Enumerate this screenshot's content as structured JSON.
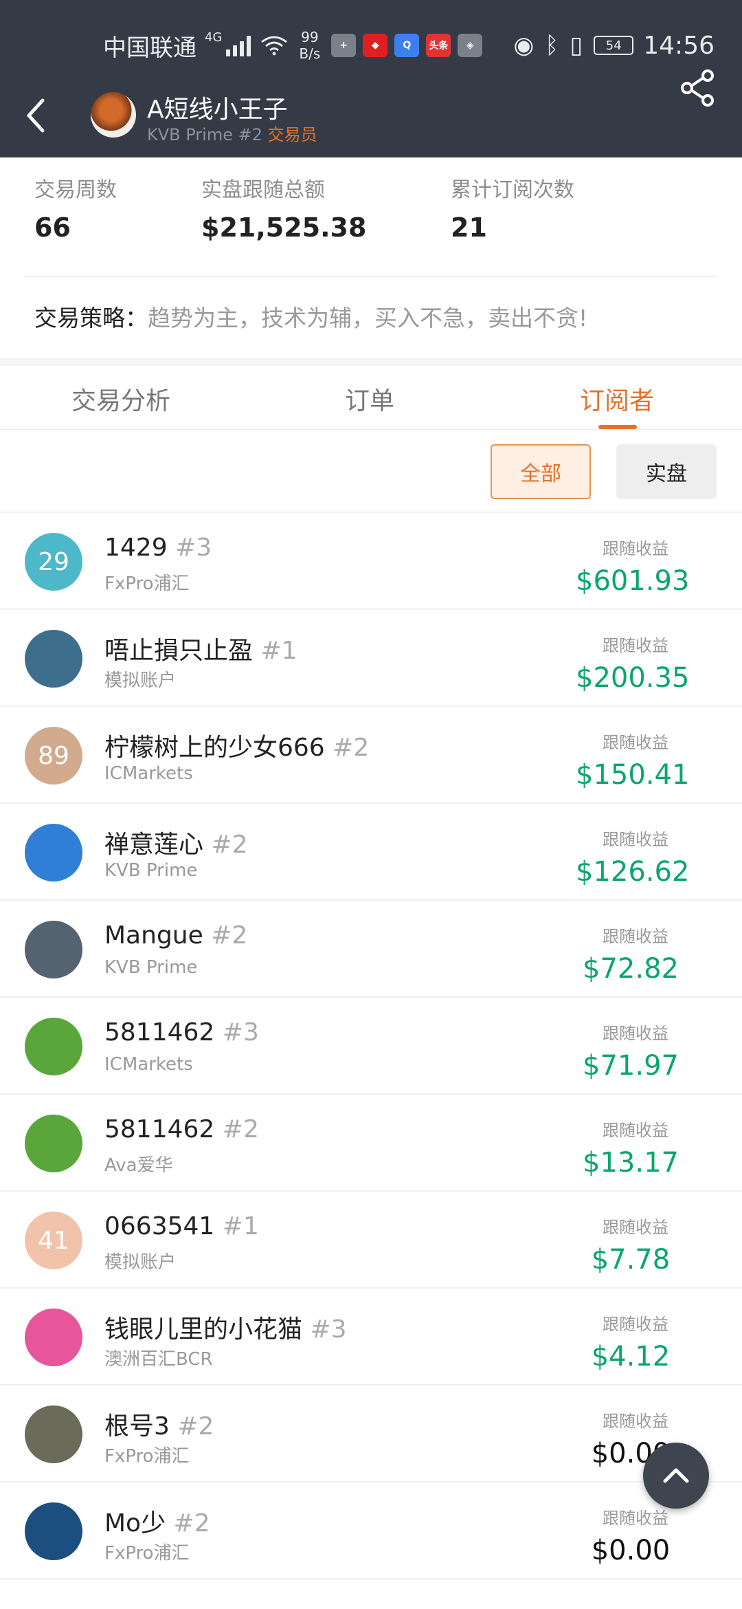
{
  "status_bar": {
    "carrier": "中国联通",
    "network": "4G",
    "speed_value": "99",
    "speed_unit": "B/s",
    "battery": "54",
    "time": "14:56",
    "app_icon_toutiao": "头条"
  },
  "header": {
    "trader_name": "A短线小王子",
    "trader_broker_rank": "KVB Prime #2",
    "trader_role": "交易员"
  },
  "stats": [
    {
      "label": "交易周数",
      "value": "66"
    },
    {
      "label": "实盘跟随总额",
      "value": "$21,525.38"
    },
    {
      "label": "累计订阅次数",
      "value": "21"
    }
  ],
  "strategy": {
    "label": "交易策略：",
    "value": "趋势为主，技术为辅，买入不急，卖出不贪!"
  },
  "tabs": [
    {
      "label": "交易分析",
      "active": false
    },
    {
      "label": "订单",
      "active": false
    },
    {
      "label": "订阅者",
      "active": true
    }
  ],
  "filters": {
    "all": "全部",
    "real": "实盘"
  },
  "return_label": "跟随收益",
  "subscribers": [
    {
      "name": "1429",
      "rank": "#3",
      "broker": "FxPro浦汇",
      "return": "$601.93",
      "avatar_text": "29",
      "avatar_color": "#4cb8c9"
    },
    {
      "name": "唔止損只止盈",
      "rank": "#1",
      "broker": "模拟账户",
      "return": "$200.35",
      "avatar_text": "",
      "avatar_color": "#3d6e8c"
    },
    {
      "name": "柠檬树上的少女666",
      "rank": "#2",
      "broker": "ICMarkets",
      "return": "$150.41",
      "avatar_text": "89",
      "avatar_color": "#d2ab8e"
    },
    {
      "name": "禅意莲心",
      "rank": "#2",
      "broker": "KVB Prime",
      "return": "$126.62",
      "avatar_text": "",
      "avatar_color": "#2f7fd6"
    },
    {
      "name": "Mangue",
      "rank": "#2",
      "broker": "KVB Prime",
      "return": "$72.82",
      "avatar_text": "",
      "avatar_color": "#556270"
    },
    {
      "name": "5811462",
      "rank": "#3",
      "broker": "ICMarkets",
      "return": "$71.97",
      "avatar_text": "",
      "avatar_color": "#5aa63b"
    },
    {
      "name": "5811462",
      "rank": "#2",
      "broker": "Ava爱华",
      "return": "$13.17",
      "avatar_text": "",
      "avatar_color": "#5aa63b"
    },
    {
      "name": "0663541",
      "rank": "#1",
      "broker": "模拟账户",
      "return": "$7.78",
      "avatar_text": "41",
      "avatar_color": "#f0c3aa"
    },
    {
      "name": "钱眼儿里的小花猫",
      "rank": "#3",
      "broker": "澳洲百汇BCR",
      "return": "$4.12",
      "avatar_text": "",
      "avatar_color": "#e7559a"
    },
    {
      "name": "根号3",
      "rank": "#2",
      "broker": "FxPro浦汇",
      "return": "$0.00",
      "avatar_text": "",
      "avatar_color": "#6b6b5a"
    },
    {
      "name": "Mo少",
      "rank": "#2",
      "broker": "FxPro浦汇",
      "return": "$0.00",
      "avatar_text": "",
      "avatar_color": "#1c4f80"
    }
  ],
  "colors": {
    "header_bg": "#343b46",
    "accent_orange": "#e8702a",
    "profit_green": "#0aa66b"
  }
}
